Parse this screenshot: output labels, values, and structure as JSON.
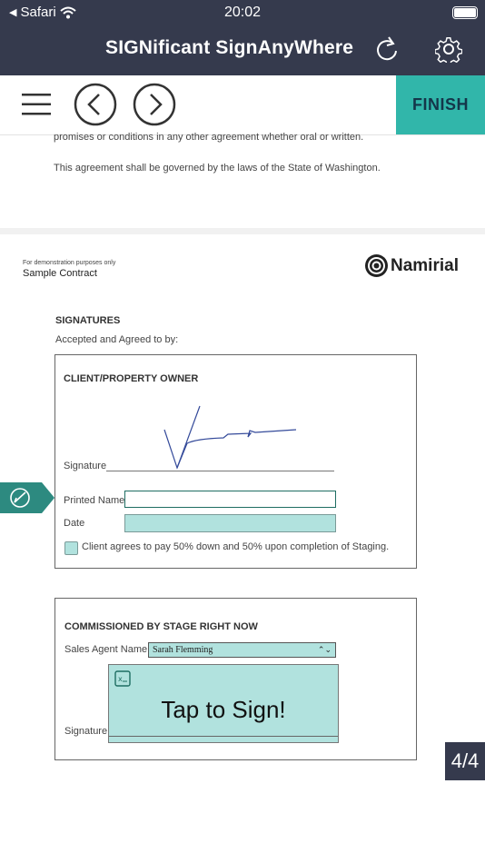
{
  "status_bar": {
    "back_app": "Safari",
    "time": "20:02"
  },
  "header": {
    "title": "SIGNificant SignAnyWhere"
  },
  "toolbar": {
    "finish_label": "FINISH"
  },
  "document": {
    "prev_page_text": [
      "promises or conditions in any other agreement whether oral or written.",
      "This agreement shall be governed by the laws of the State of Washington."
    ],
    "demo_note": "For demonstration purposes only",
    "doc_title": "Sample Contract",
    "brand_logo_text": "Namirial",
    "signatures_heading": "SIGNATURES",
    "accepted_text": "Accepted and Agreed to by:",
    "client_section": {
      "heading": "CLIENT/PROPERTY OWNER",
      "signature_label": "Signature",
      "printed_name_label": "Printed Name",
      "printed_name_value": "",
      "date_label": "Date",
      "date_value": "",
      "checkbox_label": "Client agrees to pay 50% down and 50% upon completion of Staging.",
      "checkbox_checked": false
    },
    "stage_section": {
      "heading": "COMMISSIONED BY STAGE RIGHT NOW",
      "sales_agent_label": "Sales Agent Name",
      "sales_agent_value": "Sarah Flemming",
      "signature_label": "Signature",
      "tap_to_sign": "Tap to Sign!"
    },
    "page_indicator": "4/4"
  },
  "colors": {
    "header_bg": "#353a4d",
    "accent": "#31b6aa",
    "field_fill": "#b1e2de",
    "marker": "#2d8a80"
  },
  "icons": [
    "back-arrow-icon",
    "wifi-icon",
    "battery-icon",
    "refresh-icon",
    "gear-icon",
    "menu-icon",
    "chevron-left-icon",
    "chevron-right-icon",
    "sign-marker-icon",
    "stamp-icon"
  ]
}
